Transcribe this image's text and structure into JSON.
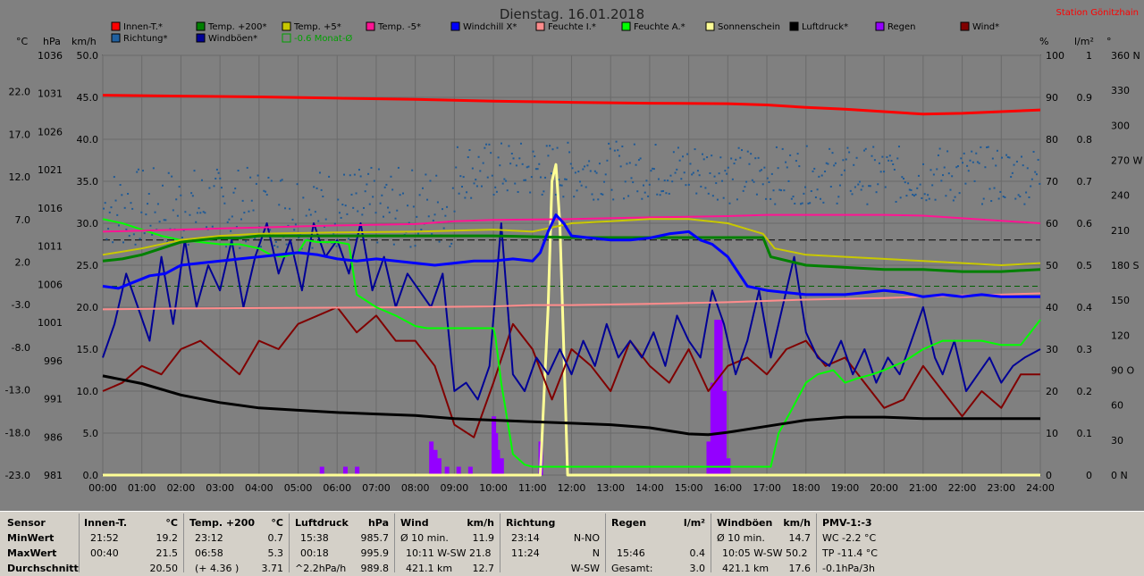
{
  "title": "Dienstag. 16.01.2018",
  "station": "Station Gönitzhain",
  "chart_data": {
    "type": "line",
    "axis_unit_labels": {
      "temp": "°C",
      "press": "hPa",
      "wind": "km/h",
      "pct": "%",
      "rain": "l/m²",
      "dir": "°"
    },
    "x_ticks": [
      "00:00",
      "01:00",
      "02:00",
      "03:00",
      "04:00",
      "05:00",
      "06:00",
      "07:00",
      "08:00",
      "09:00",
      "10:00",
      "11:00",
      "12:00",
      "13:00",
      "14:00",
      "15:00",
      "16:00",
      "17:00",
      "18:00",
      "19:00",
      "20:00",
      "21:00",
      "22:00",
      "23:00",
      "24:00"
    ],
    "xlim": [
      0,
      24
    ],
    "temp_ticks": [
      "22.0",
      "17.0",
      "12.0",
      "7.0",
      "2.0",
      "-3.0",
      "-8.0",
      "-13.0",
      "-18.0",
      "-23.0"
    ],
    "press_ticks": [
      "1036",
      "1031",
      "1026",
      "1021",
      "1016",
      "1011",
      "1006",
      "1001",
      "996",
      "991",
      "986",
      "981"
    ],
    "wind_ticks": [
      "50.0",
      "45.0",
      "40.0",
      "35.0",
      "30.0",
      "25.0",
      "20.0",
      "15.0",
      "10.0",
      "5.0",
      "0.0"
    ],
    "pct_ticks": [
      "100",
      "90",
      "80",
      "70",
      "60",
      "50",
      "40",
      "30",
      "20",
      "10",
      "0"
    ],
    "rain_ticks": [
      "1",
      "0.9",
      "0.8",
      "0.7",
      "0.6",
      "0.5",
      "0.4",
      "0.3",
      "0.2",
      "0.1",
      "0"
    ],
    "dir_ticks": [
      "360 N",
      "330",
      "300",
      "270 W",
      "240",
      "210",
      "180 S",
      "150",
      "120",
      "90 O",
      "60",
      "30",
      "0 N"
    ],
    "grid": true,
    "legend": [
      {
        "name": "Innen-T.*",
        "color": "#ff0000"
      },
      {
        "name": "Temp. +200*",
        "color": "#008000"
      },
      {
        "name": "Temp. +5*",
        "color": "#c8c800"
      },
      {
        "name": "Temp. -5*",
        "color": "#ff1493"
      },
      {
        "name": "Windchill X*",
        "color": "#0000ff"
      },
      {
        "name": "Feuchte I.*",
        "color": "#ff8c8c"
      },
      {
        "name": "Feuchte A.*",
        "color": "#00ff00"
      },
      {
        "name": "Sonnenschein",
        "color": "#ffff96"
      },
      {
        "name": "Luftdruck*",
        "color": "#000000"
      },
      {
        "name": "Regen",
        "color": "#9400ff"
      },
      {
        "name": "Wind*",
        "color": "#800000"
      },
      {
        "name": "Richtung*",
        "color": "#2060a0"
      },
      {
        "name": "Windböen*",
        "color": "#000096"
      },
      {
        "name": "-0.6 Monat-Ø",
        "color": "#00a000",
        "hollow": true
      }
    ],
    "series": [
      {
        "name": "Innen-T.*",
        "unit": "pct",
        "x": [
          0,
          2,
          4,
          6,
          8,
          10,
          12,
          14,
          16,
          17,
          18,
          19,
          20,
          21,
          22,
          23,
          24
        ],
        "values": [
          90.5,
          90.3,
          90.1,
          89.8,
          89.5,
          89.1,
          88.8,
          88.6,
          88.5,
          88.2,
          87.6,
          87.2,
          86.6,
          86,
          86.2,
          86.6,
          87
        ]
      },
      {
        "name": "Temp. +200*",
        "unit": "pct",
        "x": [
          0,
          0.5,
          1,
          1.5,
          2,
          2.5,
          3,
          3.5,
          4,
          6,
          8,
          10,
          12,
          14,
          16,
          16.9,
          17.1,
          18,
          19,
          20,
          21,
          22,
          23,
          24
        ],
        "values": [
          51,
          51.5,
          52.5,
          54,
          55.5,
          56,
          56.5,
          56.5,
          57,
          57,
          57,
          57,
          56.6,
          56.6,
          56.6,
          56.6,
          52,
          50,
          49.5,
          49,
          49,
          48.5,
          48.5,
          49
        ]
      },
      {
        "name": "Temp. +5*",
        "unit": "pct",
        "x": [
          0,
          1,
          2,
          3,
          4,
          6,
          8,
          10,
          11,
          12,
          13,
          14,
          15,
          16,
          16.9,
          17.2,
          18,
          19,
          20,
          21,
          22,
          23,
          24
        ],
        "values": [
          52.5,
          54,
          56,
          57,
          57.5,
          57.8,
          58,
          58.5,
          58,
          60,
          60.5,
          61,
          61,
          60,
          57.5,
          54,
          52.5,
          52,
          51.5,
          51,
          50.5,
          50,
          50.5
        ]
      },
      {
        "name": "Temp. -5*",
        "unit": "pct",
        "x": [
          0,
          2,
          4,
          6,
          8,
          9,
          10,
          12,
          14,
          16,
          17,
          18,
          19,
          20,
          21,
          22,
          23,
          24
        ],
        "values": [
          58,
          58.5,
          59,
          59.5,
          59.8,
          60.5,
          60.8,
          61,
          61.4,
          61.7,
          62,
          62,
          62,
          62,
          61.8,
          61.2,
          60.6,
          60
        ]
      },
      {
        "name": "Windchill X*",
        "unit": "pct",
        "x": [
          0,
          0.4,
          0.8,
          1.2,
          1.6,
          2,
          2.5,
          3,
          3.5,
          4,
          4.5,
          5,
          5.5,
          6,
          6.5,
          7,
          7.5,
          8,
          8.5,
          9,
          9.5,
          10,
          10.5,
          11,
          11.2,
          11.4,
          11.6,
          11.8,
          12,
          12.5,
          13,
          13.5,
          14,
          14.5,
          15,
          15.3,
          15.6,
          16,
          16.5,
          17,
          17.5,
          18,
          18.5,
          19,
          19.5,
          20,
          20.5,
          21,
          21.5,
          22,
          22.5,
          23,
          23.5,
          24
        ],
        "values": [
          45,
          44.5,
          46,
          47.5,
          48,
          50,
          50.5,
          51,
          51.5,
          52,
          52.5,
          53,
          52.5,
          51.5,
          51,
          51.5,
          51,
          50.5,
          50,
          50.5,
          51,
          51,
          51.5,
          51,
          53,
          58,
          62,
          60,
          57,
          56.5,
          56,
          56,
          56.5,
          57.5,
          58,
          56,
          55,
          52,
          45,
          44,
          43.5,
          43,
          43,
          43,
          43.5,
          44,
          43.5,
          42.5,
          43,
          42.5,
          43,
          42.5,
          42.5,
          42.5
        ]
      },
      {
        "name": "Feuchte I.*",
        "unit": "pct",
        "x": [
          0,
          2,
          4,
          6,
          8,
          10,
          11,
          12,
          14,
          16,
          18,
          20,
          22,
          23,
          24
        ],
        "values": [
          39.5,
          39.7,
          39.8,
          39.9,
          40,
          40.2,
          40.5,
          40.5,
          40.8,
          41.2,
          41.8,
          42.2,
          42.8,
          43,
          43.3
        ]
      },
      {
        "name": "Feuchte A.*",
        "unit": "pct",
        "x": [
          0,
          0.5,
          1,
          1.5,
          2,
          2.5,
          3,
          3.5,
          4,
          4.3,
          4.6,
          5,
          5.2,
          5.5,
          6,
          6.3,
          6.5,
          7,
          7.5,
          8,
          8.3,
          8.6,
          10,
          10.05,
          10.2,
          10.5,
          10.8,
          11,
          11.5,
          12,
          14,
          16,
          17.1,
          17.3,
          17.6,
          18,
          18.3,
          18.7,
          19,
          19.3,
          19.7,
          20,
          20.5,
          21,
          21.5,
          22,
          22.5,
          23,
          23.5,
          24
        ],
        "values": [
          61,
          60,
          58.5,
          57,
          56,
          55.5,
          55,
          55,
          54,
          52.5,
          52,
          53,
          56,
          55.5,
          55.5,
          55,
          43,
          40,
          38,
          35.5,
          35,
          35,
          35,
          33,
          22,
          5,
          2.5,
          2,
          2,
          2,
          2,
          2,
          2,
          10,
          15,
          22,
          24,
          25,
          22,
          23,
          24,
          25,
          27,
          30,
          32,
          32,
          32,
          31,
          31,
          37
        ]
      },
      {
        "name": "Sonnenschein",
        "unit": "pct",
        "x": [
          0,
          11.2,
          11.4,
          11.5,
          11.6,
          11.7,
          11.8,
          11.9,
          24
        ],
        "values": [
          0,
          0,
          40,
          70,
          74,
          60,
          30,
          0,
          0
        ]
      },
      {
        "name": "Luftdruck*",
        "unit": "press",
        "x": [
          0,
          1,
          2,
          3,
          4,
          5,
          6,
          7,
          8,
          9,
          10,
          11,
          12,
          13,
          14,
          15,
          15.5,
          16,
          17,
          18,
          19,
          20,
          21,
          22,
          23,
          24
        ],
        "values": [
          994,
          993,
          991.5,
          990.5,
          989.8,
          989.5,
          989.2,
          989,
          988.8,
          988.4,
          988.2,
          988,
          987.8,
          987.6,
          987.2,
          986.4,
          986.3,
          986.6,
          987.4,
          988.2,
          988.6,
          988.6,
          988.4,
          988.4,
          988.4,
          988.4
        ]
      },
      {
        "name": "Regen",
        "unit": "rain",
        "type": "bar",
        "x": [
          5.6,
          6.2,
          6.5,
          8.4,
          8.5,
          8.6,
          8.8,
          9.1,
          9.4,
          10,
          10.05,
          10.1,
          10.2,
          11.2,
          15.5,
          15.6,
          15.7,
          15.8,
          15.9,
          16
        ],
        "values": [
          0.02,
          0.02,
          0.02,
          0.08,
          0.06,
          0.04,
          0.02,
          0.02,
          0.02,
          0.14,
          0.1,
          0.06,
          0.04,
          0.08,
          0.08,
          0.22,
          0.37,
          0.37,
          0.2,
          0.04
        ]
      },
      {
        "name": "Wind*",
        "unit": "wind",
        "x": [
          0,
          0.5,
          1,
          1.5,
          2,
          2.5,
          3,
          3.5,
          4,
          4.5,
          5,
          5.5,
          6,
          6.5,
          7,
          7.5,
          8,
          8.5,
          9,
          9.5,
          10,
          10.5,
          11,
          11.5,
          12,
          12.5,
          13,
          13.5,
          14,
          14.5,
          15,
          15.5,
          16,
          16.5,
          17,
          17.5,
          18,
          18.5,
          19,
          19.5,
          20,
          20.5,
          21,
          21.5,
          22,
          22.5,
          23,
          23.5,
          24
        ],
        "values": [
          10,
          11,
          13,
          12,
          15,
          16,
          14,
          12,
          16,
          15,
          18,
          19,
          20,
          17,
          19,
          16,
          16,
          13,
          6,
          4.5,
          11,
          18,
          15,
          9,
          15,
          13,
          10,
          16,
          13,
          11,
          15,
          10,
          13,
          14,
          12,
          15,
          16,
          13,
          14,
          11,
          8,
          9,
          13,
          10,
          7,
          10,
          8,
          12,
          12
        ]
      },
      {
        "name": "Windböen*",
        "unit": "wind",
        "x": [
          0,
          0.3,
          0.6,
          0.9,
          1.2,
          1.5,
          1.8,
          2.1,
          2.4,
          2.7,
          3,
          3.3,
          3.6,
          3.9,
          4.2,
          4.5,
          4.8,
          5.1,
          5.4,
          5.7,
          6,
          6.3,
          6.6,
          6.9,
          7.2,
          7.5,
          7.8,
          8.1,
          8.4,
          8.7,
          9,
          9.3,
          9.6,
          9.9,
          10.2,
          10.5,
          10.8,
          11.1,
          11.4,
          11.7,
          12,
          12.3,
          12.6,
          12.9,
          13.2,
          13.5,
          13.8,
          14.1,
          14.4,
          14.7,
          15,
          15.3,
          15.6,
          15.9,
          16.2,
          16.5,
          16.8,
          17.1,
          17.4,
          17.7,
          18,
          18.3,
          18.6,
          18.9,
          19.2,
          19.5,
          19.8,
          20.1,
          20.4,
          20.7,
          21,
          21.3,
          21.5,
          21.8,
          22.1,
          22.4,
          22.7,
          23,
          23.3,
          23.6,
          24
        ],
        "values": [
          14,
          18,
          24,
          20,
          16,
          26,
          18,
          28,
          20,
          25,
          22,
          28,
          20,
          26,
          30,
          24,
          28,
          22,
          30,
          26,
          28,
          24,
          30,
          22,
          26,
          20,
          24,
          22,
          20,
          24,
          10,
          11,
          9,
          13,
          30,
          12,
          10,
          14,
          12,
          15,
          12,
          16,
          13,
          18,
          14,
          16,
          14,
          17,
          13,
          19,
          16,
          14,
          22,
          18,
          12,
          16,
          22,
          14,
          20,
          26,
          17,
          14,
          13,
          16,
          12,
          15,
          11,
          14,
          12,
          16,
          20,
          14,
          12,
          16,
          10,
          12,
          14,
          11,
          13,
          14,
          15
        ]
      }
    ],
    "direction_scatter": {
      "unit": "dir",
      "note": "Richtung*"
    }
  },
  "stats": {
    "sensor": {
      "header": "Sensor",
      "rows": [
        "MinWert",
        "MaxWert",
        "Durchschnitt"
      ]
    },
    "innen": {
      "header": "Innen-T.",
      "unit": "°C",
      "rows": [
        [
          "21:52",
          "19.2"
        ],
        [
          "00:40",
          "21.5"
        ],
        [
          "",
          "20.50"
        ]
      ]
    },
    "temp200": {
      "header": "Temp. +200",
      "unit": "°C",
      "rows": [
        [
          "23:12",
          "0.7"
        ],
        [
          "06:58",
          "5.3"
        ],
        [
          "(+ 4.36 )",
          "3.71"
        ]
      ]
    },
    "luftdruck": {
      "header": "Luftdruck",
      "unit": "hPa",
      "rows": [
        [
          "15:38",
          "985.7"
        ],
        [
          "00:18",
          "995.9"
        ],
        [
          "^2.2hPa/h",
          "989.8"
        ]
      ]
    },
    "wind": {
      "header": "Wind",
      "unit": "km/h",
      "rows": [
        [
          "Ø 10 min.",
          "11.9"
        ],
        [
          "10:11   W-SW 21.8",
          ""
        ],
        [
          "421.1 km",
          "12.7"
        ]
      ]
    },
    "richtung": {
      "header": "Richtung",
      "unit": "",
      "rows": [
        [
          "23:14",
          "N-NO"
        ],
        [
          "11:24",
          "N"
        ],
        [
          "",
          "W-SW"
        ]
      ]
    },
    "regen": {
      "header": "Regen",
      "unit": "l/m²",
      "rows": [
        [
          "",
          ""
        ],
        [
          "15:46",
          "0.4"
        ],
        [
          "Gesamt:",
          "3.0"
        ]
      ]
    },
    "windboeen": {
      "header": "Windböen",
      "unit": "km/h",
      "rows": [
        [
          "Ø 10 min.",
          "14.7"
        ],
        [
          "10:05   W-SW 50.2",
          ""
        ],
        [
          "421.1 km",
          "17.6"
        ]
      ]
    },
    "pmv": {
      "header": "PMV-1:-3",
      "unit": "",
      "rows": [
        [
          "WC -2.2 °C",
          ""
        ],
        [
          "TP -11.4 °C",
          ""
        ],
        [
          "-0.1hPa/3h",
          ""
        ]
      ]
    }
  }
}
